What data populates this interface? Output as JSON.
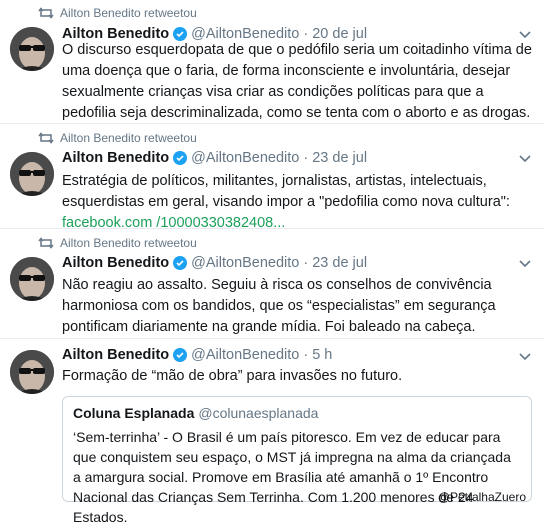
{
  "tweets": [
    {
      "retweet_label": "Ailton Benedito retweetou",
      "name": "Ailton Benedito",
      "handle": "@AiltonBenedito",
      "date": "20 de jul",
      "text": "O discurso esquerdopata de que o pedófilo seria um coitadinho vítima de uma doença que o faria, de forma inconsciente e involuntária, desejar sexualmente crianças visa criar as condições políticas para que a pedofilia seja descriminalizada, como se tenta com o aborto e as drogas."
    },
    {
      "retweet_label": "Ailton Benedito retweetou",
      "name": "Ailton Benedito",
      "handle": "@AiltonBenedito",
      "date": "23 de jul",
      "text": "Estratégia de políticos, militantes, jornalistas, artistas, intelectuais, esquerdistas em geral, visando impor a \"pedofilia como nova cultura\": ",
      "link": "facebook.com /10000330382408..."
    },
    {
      "retweet_label": "Ailton Benedito retweetou",
      "name": "Ailton Benedito",
      "handle": "@AiltonBenedito",
      "date": "23 de jul",
      "text": "Não reagiu ao assalto. Seguiu à risca os conselhos de convivência harmoniosa com os bandidos, que os “especialistas” em segurança pontificam diariamente na grande mídia. Foi baleado na cabeça."
    },
    {
      "name": "Ailton Benedito",
      "handle": "@AiltonBenedito",
      "date": "5 h",
      "text": "Formação de “mão de obra” para invasões no futuro."
    }
  ],
  "quote": {
    "name": "Coluna Esplanada",
    "handle": "@colunaesplanada",
    "text": "‘Sem-terrinha’ - O Brasil é um país pitoresco. Em vez de educar para que conquistem seu espaço, o MST já impregna na alma da criançada a amargura social. Promove em Brasília até amanhã o 1º Encontro Nacional das Crianças Sem Terrinha. Com 1.200 menores de 24 Estados."
  },
  "separator": "·",
  "watermark": "@PetralhaZuero",
  "colors": {
    "link": "#1da05a",
    "verified": "#1da1f2",
    "muted": "#657786"
  },
  "icons": [
    "retweet-icon",
    "verified-icon",
    "chevron-down-icon"
  ]
}
